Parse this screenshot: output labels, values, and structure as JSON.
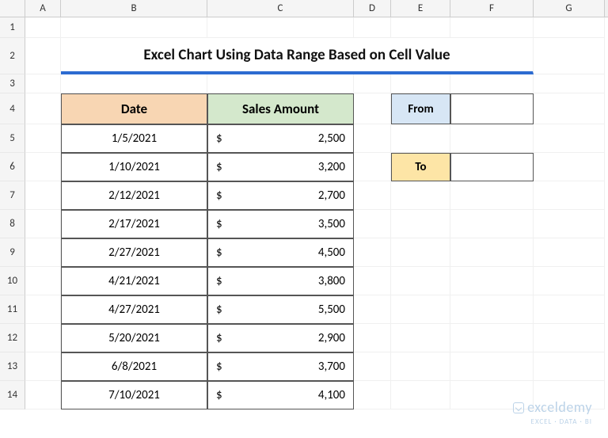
{
  "columns": [
    "A",
    "B",
    "C",
    "D",
    "E",
    "F",
    "G"
  ],
  "rows": [
    "1",
    "2",
    "3",
    "4",
    "5",
    "6",
    "7",
    "8",
    "9",
    "10",
    "11",
    "12",
    "13",
    "14"
  ],
  "title": "Excel Chart Using Data Range Based on Cell Value",
  "headers": {
    "date": "Date",
    "amount": "Sales Amount"
  },
  "labels": {
    "from": "From",
    "to": "To"
  },
  "currency": "$",
  "data": [
    {
      "date": "1/5/2021",
      "amount": "2,500"
    },
    {
      "date": "1/10/2021",
      "amount": "3,200"
    },
    {
      "date": "2/12/2021",
      "amount": "2,700"
    },
    {
      "date": "2/17/2021",
      "amount": "3,500"
    },
    {
      "date": "2/27/2021",
      "amount": "4,500"
    },
    {
      "date": "4/21/2021",
      "amount": "3,800"
    },
    {
      "date": "4/27/2021",
      "amount": "5,500"
    },
    {
      "date": "5/20/2021",
      "amount": "2,900"
    },
    {
      "date": "6/8/2021",
      "amount": "3,700"
    },
    {
      "date": "7/10/2021",
      "amount": "4,100"
    }
  ],
  "from_value": "",
  "to_value": "",
  "watermark": {
    "brand": "exceldemy",
    "sub": "EXCEL · DATA · BI"
  }
}
